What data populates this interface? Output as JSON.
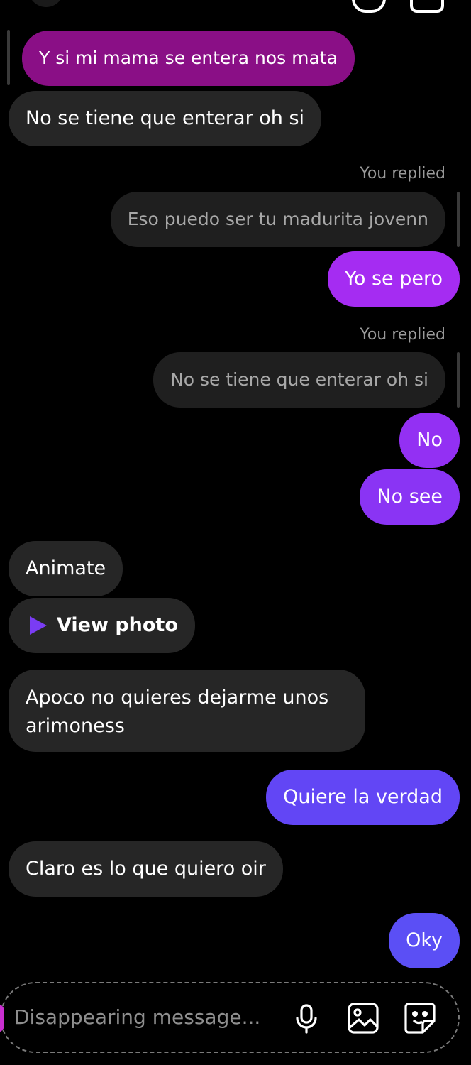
{
  "colors": {
    "background": "#000000",
    "received_bubble": "#262626",
    "quoted_bubble": "#1f1f1f",
    "sent_magenta": "#8a0f86",
    "sent_purple": "#a52cf2",
    "sent_violet": "#7a3cf4",
    "sent_blue": "#5b4ff5"
  },
  "messages": {
    "m1": "Y si mi mama se entera nos mata",
    "m2": "No se tiene que enterar oh si",
    "reply1_label": "You replied",
    "reply1_quote": "Eso puedo ser tu madurita jovenn",
    "m3": "Yo se pero",
    "reply2_label": "You replied",
    "reply2_quote": "No se tiene que enterar oh si",
    "m4": "No",
    "m5": "No see",
    "m6": "Animate",
    "view_photo": "View photo",
    "m7_line1": "Apoco no quieres dejarme unos",
    "m7_line2": "arimoness",
    "m8": "Quiere la verdad",
    "m9": "Claro es lo que quiero oir",
    "m10": "Oky"
  },
  "composer": {
    "placeholder": "Disappearing message..."
  },
  "icons": {
    "mic": "microphone-icon",
    "gallery": "image-icon",
    "sticker": "sticker-icon",
    "play": "play-icon"
  }
}
